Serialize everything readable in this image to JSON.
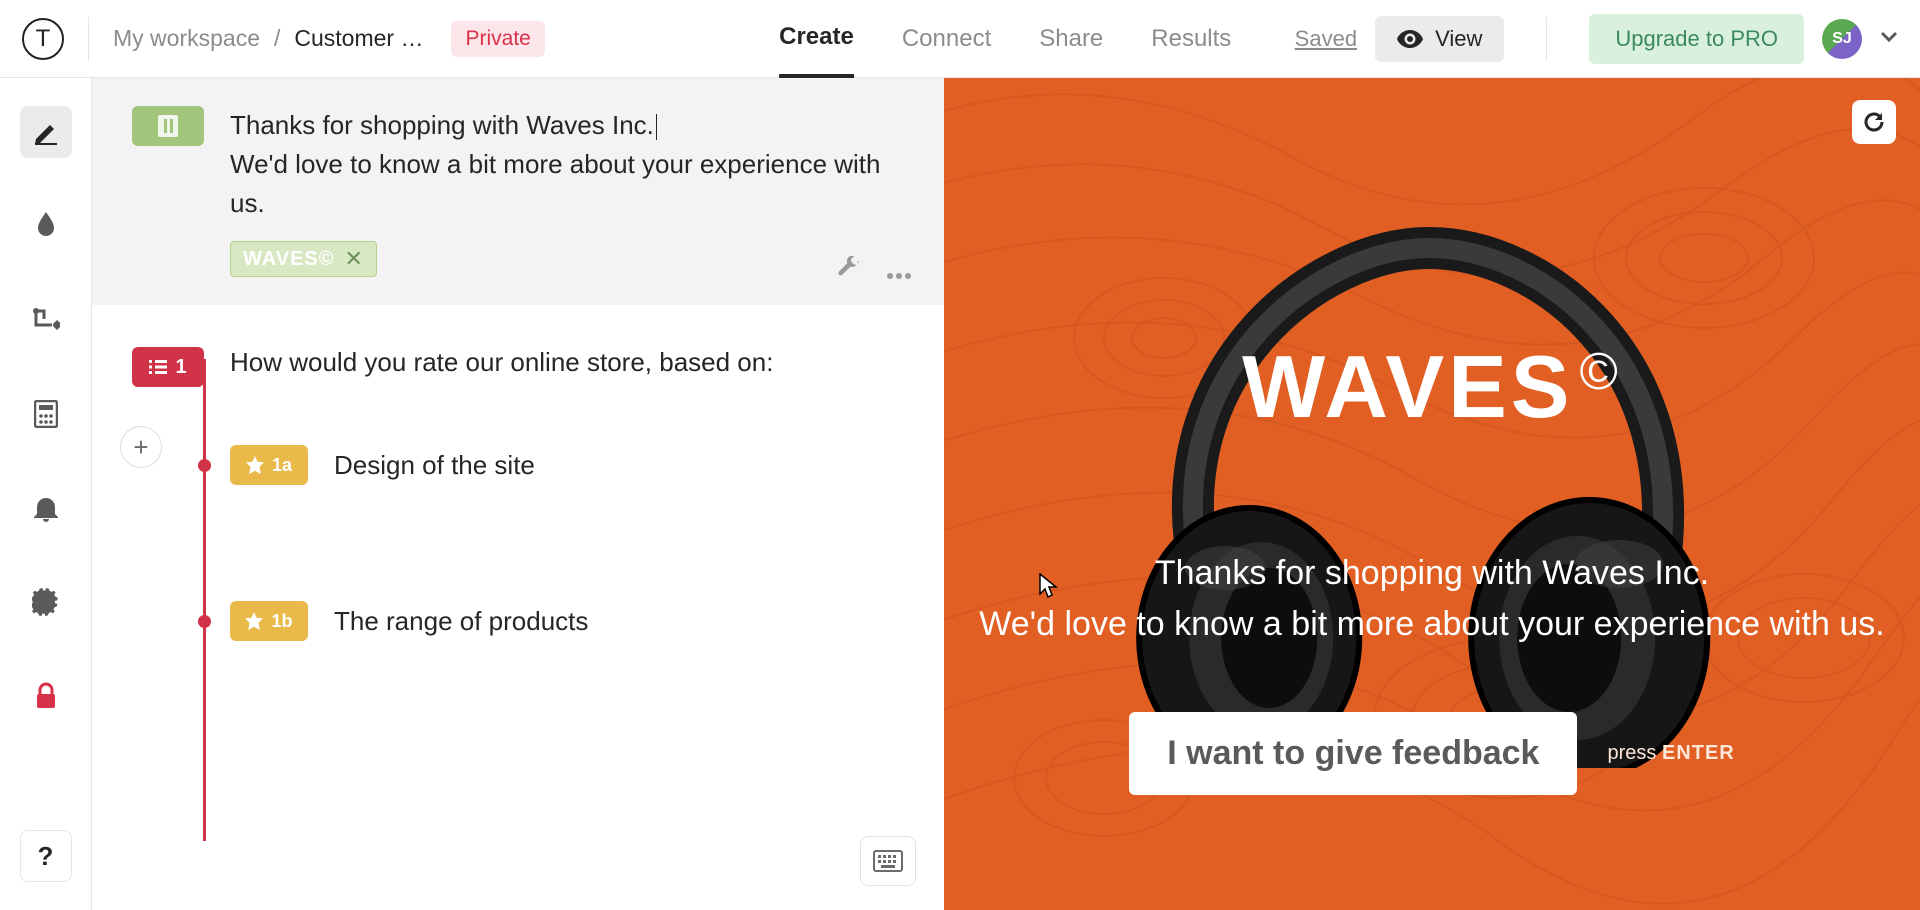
{
  "header": {
    "logo_letter": "T",
    "breadcrumb_workspace": "My workspace",
    "breadcrumb_separator": "/",
    "breadcrumb_project": "Customer …",
    "badge_private": "Private",
    "tabs": {
      "create": "Create",
      "connect": "Connect",
      "share": "Share",
      "results": "Results"
    },
    "saved": "Saved",
    "view": "View",
    "upgrade": "Upgrade to PRO",
    "avatar_initials": "SJ"
  },
  "editor": {
    "welcome_line1": "Thanks for shopping with Waves Inc.",
    "welcome_line2": "We'd love to know a bit more about your experience with us.",
    "image_chip": "WAVES©",
    "question1": {
      "number": "1",
      "text": "How would you rate our online store, based on:",
      "subs": [
        {
          "id": "1a",
          "label": "Design of the site"
        },
        {
          "id": "1b",
          "label": "The range of products"
        }
      ]
    }
  },
  "preview": {
    "brand": "WAVES",
    "brand_mark": "©",
    "line1": "Thanks for shopping with Waves Inc.",
    "line2": "We'd love to know a bit more about your experience with us.",
    "cta": "I want to give feedback",
    "press_prefix": "press ",
    "press_key": "ENTER"
  }
}
